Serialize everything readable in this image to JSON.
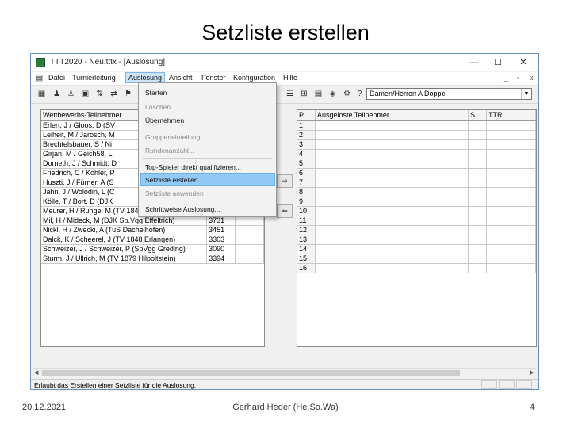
{
  "slide": {
    "title": "Setzliste erstellen",
    "date": "20.12.2021",
    "author": "Gerhard Heder (He.So.Wa)",
    "page": "4"
  },
  "window": {
    "title": "TTT2020 - Neu.tttx - [Auslosung]",
    "minimize": "—",
    "maximize": "☐",
    "close": "✕"
  },
  "menubar": {
    "items": [
      "Datei",
      "Turnierleitung",
      "Auslosung",
      "Ansicht",
      "Fenster",
      "Konfiguration",
      "Hilfe"
    ],
    "mdi": [
      "_",
      "▫",
      "x"
    ]
  },
  "toolbar": {
    "competition": "Damen/Herren A Doppel",
    "icons": [
      "save-icon",
      "people-icon",
      "person-icon",
      "form-icon",
      "sort-icon",
      "swap-icon",
      "flag-icon",
      "list-icon",
      "tree-icon",
      "grid-icon",
      "book-icon",
      "gear-icon",
      "help-icon"
    ]
  },
  "left_table": {
    "headers": [
      "Wettbewerbs-Teilnehmer",
      "",
      ""
    ],
    "rows": [
      [
        "Erlert, J / Gloos, D (SV",
        "",
        ""
      ],
      [
        "Leiheit, M / Jarosch, M",
        "",
        ""
      ],
      [
        "Brechtelsbauer, S / Ni",
        "",
        ""
      ],
      [
        "Girjan, M / Geich58, L",
        "",
        ""
      ],
      [
        "Dorneth, J / Schmidt, D",
        "",
        ""
      ],
      [
        "Friedrich, C / Kohler, P",
        "",
        ""
      ],
      [
        "Huszti, J / Fürner, A (S",
        "",
        ""
      ],
      [
        "Jahn, J / Wolodin, L (C",
        "",
        ""
      ],
      [
        "Kölle, T / Bort, D (DJK",
        "",
        ""
      ],
      [
        "Meurer, H / Runge, M (TV 1848 Erlangen)",
        "",
        ""
      ],
      [
        "Mil, H / Mideck, M (DJK Sp.Vgg Effeltrich)",
        "3731",
        ""
      ],
      [
        "Nickl, H / Zwecki, A (TuS Dachelhofen)",
        "3451",
        ""
      ],
      [
        "Dalck, K / Scheerel, J (TV 1848 Erlangen)",
        "3303",
        ""
      ],
      [
        "Schweizer, J / Schweizer, P (SpVgg Greding)",
        "3090",
        ""
      ],
      [
        "Sturm, J / Ullrich, M (TV 1879 Hilpoltstein)",
        "3394",
        ""
      ]
    ]
  },
  "right_table": {
    "headers": [
      "P...",
      "Ausgeloste Teilnehmer",
      "S...",
      "TTR..."
    ],
    "positions": [
      "1",
      "2",
      "3",
      "4",
      "5",
      "6",
      "7",
      "8",
      "9",
      "10",
      "11",
      "12",
      "13",
      "14",
      "15",
      "16"
    ]
  },
  "arrows": {
    "right": "➔",
    "left": "⬅"
  },
  "dropdown": {
    "items": [
      {
        "label": "Starten",
        "disabled": false
      },
      {
        "label": "Löschen",
        "disabled": true
      },
      {
        "label": "Übernehmen",
        "disabled": false
      },
      {
        "label": "Gruppeneinteilung...",
        "disabled": true
      },
      {
        "label": "Rundenanzahl...",
        "disabled": true
      },
      {
        "label": "Top-Spieler direkt qualifizieren...",
        "disabled": false
      },
      {
        "label": "Setzliste erstellen...",
        "disabled": false,
        "highlighted": true
      },
      {
        "label": "Setzliste anwenden",
        "disabled": true
      },
      {
        "label": "Schrittweise Auslosung...",
        "disabled": false
      }
    ]
  },
  "statusbar": {
    "text": "Erlaubt das Erstellen einer Setzliste für die Auslosung."
  },
  "colors": {
    "highlight": "#91c9f7",
    "border": "#6a8fbd"
  }
}
